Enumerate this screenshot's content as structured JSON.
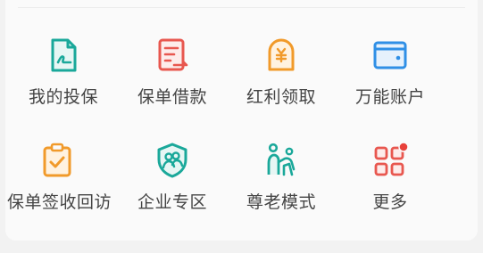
{
  "menu": {
    "items": [
      {
        "label": "我的投保",
        "icon": "insurance-doc-icon",
        "color": "#1aa89a"
      },
      {
        "label": "保单借款",
        "icon": "policy-loan-icon",
        "color": "#e8574f"
      },
      {
        "label": "红利领取",
        "icon": "dividend-icon",
        "color": "#f19a2a"
      },
      {
        "label": "万能账户",
        "icon": "wallet-icon",
        "color": "#2f8fe6"
      },
      {
        "label": "保单签收回访",
        "icon": "clipboard-check-icon",
        "color": "#f19a2a"
      },
      {
        "label": "企业专区",
        "icon": "enterprise-shield-icon",
        "color": "#1aa89a"
      },
      {
        "label": "尊老模式",
        "icon": "elder-mode-icon",
        "color": "#1aa89a"
      },
      {
        "label": "更多",
        "icon": "grid-more-icon",
        "color": "#e8574f"
      }
    ]
  }
}
